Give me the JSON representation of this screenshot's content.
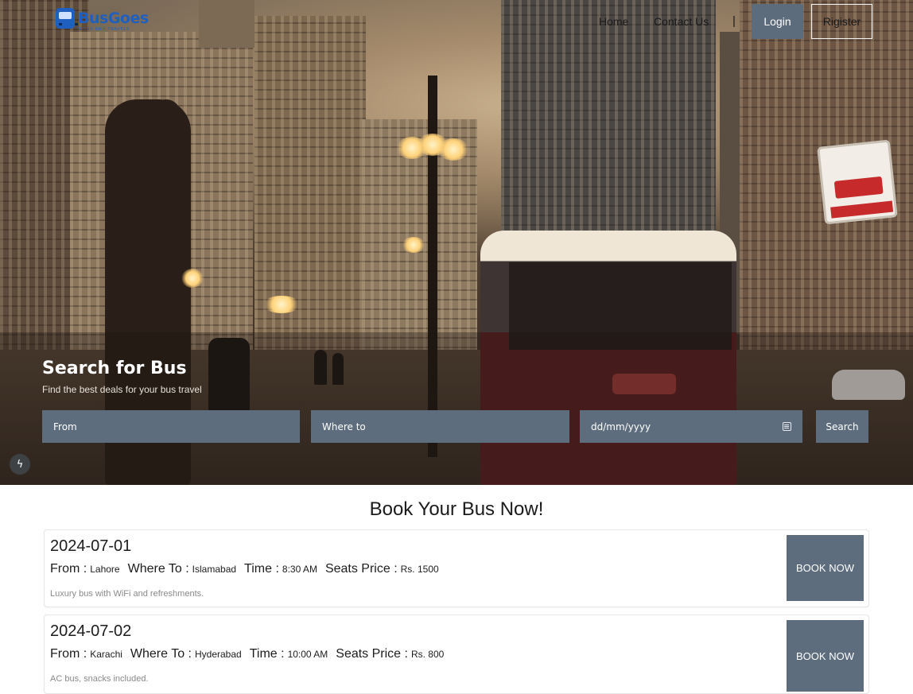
{
  "brand": {
    "name": "BusGoes",
    "tagline": "TOURS AND TRAVELS",
    "logo_icon": "bus-icon"
  },
  "nav": {
    "home": "Home",
    "contact": "Contact Us",
    "separator": "|",
    "login": "Login",
    "register": "Rigister"
  },
  "search": {
    "title": "Search for Bus",
    "subtitle": "Find the best deals for your bus travel",
    "from_placeholder": "From",
    "to_placeholder": "Where to",
    "date_placeholder": "dd/mm/yyyy",
    "button": "Search",
    "calendar_icon": "calendar-icon"
  },
  "floating_icon": "lightning-bolt-icon",
  "listings": {
    "title": "Book Your Bus Now!",
    "labels": {
      "from": "From :",
      "to": "Where To :",
      "time": "Time :",
      "price": "Seats Price :"
    },
    "book_label": "BOOK NOW",
    "items": [
      {
        "date": "2024-07-01",
        "from": "Lahore",
        "to": "Islamabad",
        "time": "8:30 AM",
        "price": "Rs. 1500",
        "description": "Luxury bus with WiFi and refreshments."
      },
      {
        "date": "2024-07-02",
        "from": "Karachi",
        "to": "Hyderabad",
        "time": "10:00 AM",
        "price": "Rs. 800",
        "description": "AC bus, snacks included."
      }
    ]
  },
  "colors": {
    "accent": "#5d6d7e",
    "login_bg": "#5c6c7c",
    "brand": "#1f5fbf"
  }
}
